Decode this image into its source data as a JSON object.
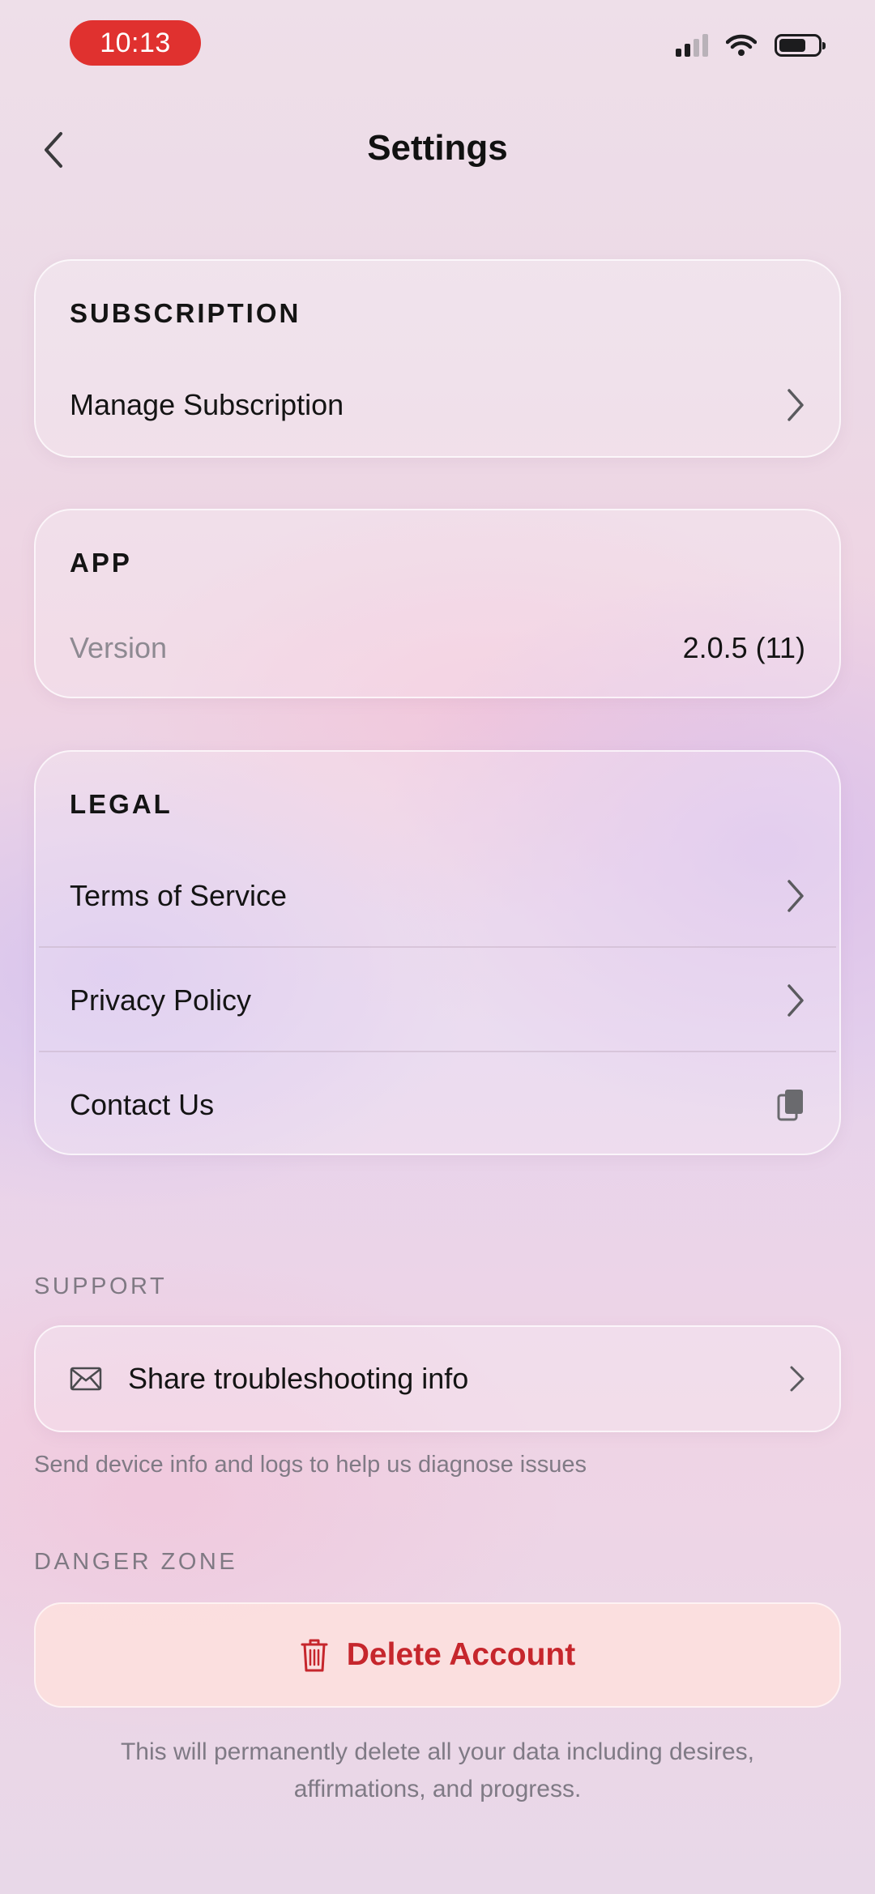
{
  "status_bar": {
    "time": "10:13"
  },
  "header": {
    "title": "Settings",
    "back_icon": "chevron-left-icon"
  },
  "subscription": {
    "header": "SUBSCRIPTION",
    "manage_label": "Manage Subscription"
  },
  "app": {
    "header": "APP",
    "version_label": "Version",
    "version_value": "2.0.5 (11)"
  },
  "legal": {
    "header": "LEGAL",
    "items": [
      {
        "label": "Terms of Service",
        "icon": "chevron-right-icon"
      },
      {
        "label": "Privacy Policy",
        "icon": "chevron-right-icon"
      },
      {
        "label": "Contact Us",
        "icon": "copy-icon"
      }
    ]
  },
  "support": {
    "section_label": "SUPPORT",
    "share_label": "Share troubleshooting info",
    "share_icon": "envelope-icon",
    "helper": "Send device info and logs to help us diagnose issues"
  },
  "danger_zone": {
    "section_label": "DANGER ZONE",
    "delete_label": "Delete Account",
    "delete_icon": "trash-icon",
    "delete_color": "#c6262c",
    "note": "This will permanently delete all your data including desires, affirmations, and progress."
  }
}
